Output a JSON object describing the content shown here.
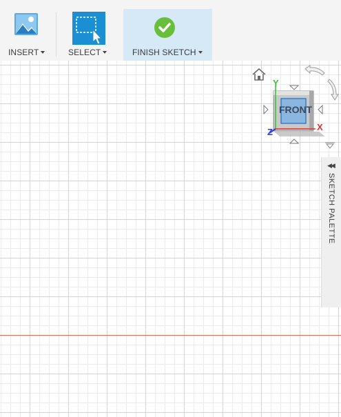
{
  "toolbar": {
    "insert_label": "INSERT",
    "select_label": "SELECT",
    "finish_sketch_label": "FINISH SKETCH"
  },
  "viewcube": {
    "face_label": "FRONT",
    "axis_y": "Y",
    "axis_x": "X",
    "axis_z": "Z"
  },
  "palette": {
    "label": "SKETCH PALETTE"
  },
  "colors": {
    "accent_blue": "#1b8fd3",
    "finish_highlight": "#d5e9f6",
    "finish_green": "#6abf3a",
    "axis_red": "#e06a56",
    "y_axis": "#3cc13c",
    "x_axis": "#e53030",
    "z_axis": "#2f3ee0"
  }
}
